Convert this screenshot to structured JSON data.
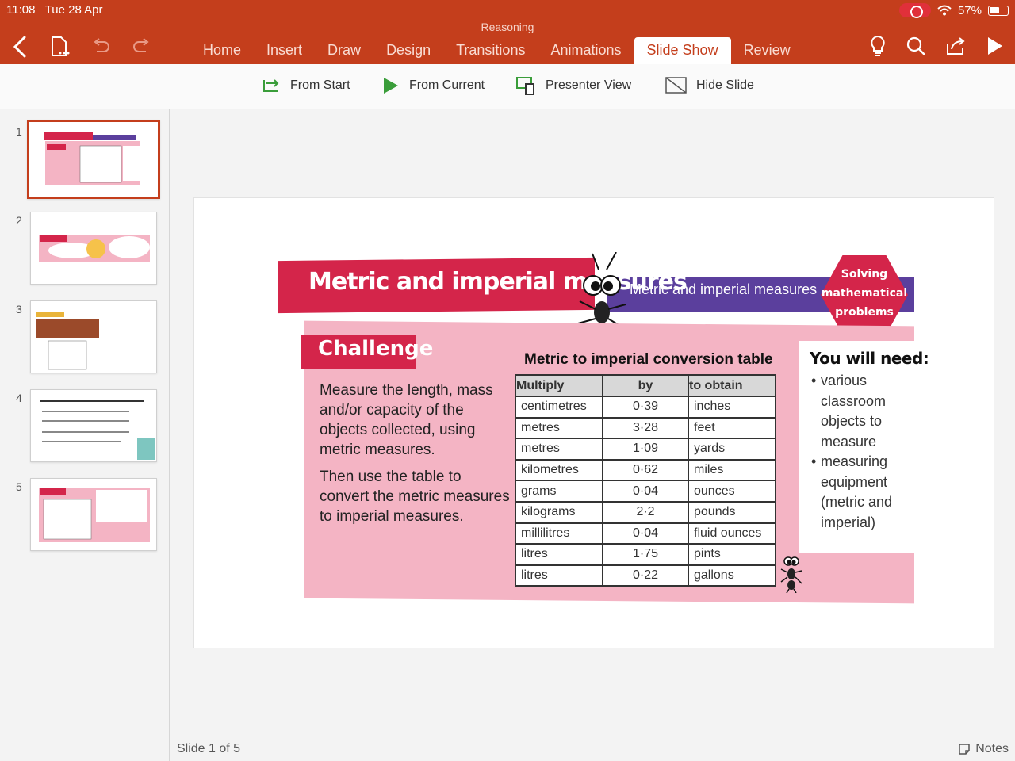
{
  "status": {
    "time": "11:08",
    "date": "Tue 28 Apr",
    "battery": "57%"
  },
  "document": {
    "title": "Reasoning"
  },
  "tabs": [
    {
      "label": "Home",
      "active": false
    },
    {
      "label": "Insert",
      "active": false
    },
    {
      "label": "Draw",
      "active": false
    },
    {
      "label": "Design",
      "active": false
    },
    {
      "label": "Transitions",
      "active": false
    },
    {
      "label": "Animations",
      "active": false
    },
    {
      "label": "Slide Show",
      "active": true
    },
    {
      "label": "Review",
      "active": false
    }
  ],
  "ribbon": {
    "from_start": "From Start",
    "from_current": "From Current",
    "presenter_view": "Presenter View",
    "hide_slide": "Hide Slide"
  },
  "thumbnails": {
    "numbers": [
      "1",
      "2",
      "3",
      "4",
      "5"
    ],
    "selected": 1
  },
  "slide": {
    "header_title": "Metric and imperial measures",
    "header_subtitle": "Metric and imperial measures",
    "badge_line1": "Solving",
    "badge_line2": "mathematical",
    "badge_line3": "problems",
    "challenge_label": "Challenge",
    "challenge_para1": "Measure the length, mass and/or capacity of the objects collected, using metric measures.",
    "challenge_para2": "Then use the table to convert the metric measures to imperial measures.",
    "table_title": "Metric to imperial conversion table",
    "table_headers": [
      "Multiply",
      "by",
      "to obtain"
    ],
    "table_rows": [
      [
        "centimetres",
        "0·39",
        "inches"
      ],
      [
        "metres",
        "3·28",
        "feet"
      ],
      [
        "metres",
        "1·09",
        "yards"
      ],
      [
        "kilometres",
        "0·62",
        "miles"
      ],
      [
        "grams",
        "0·04",
        "ounces"
      ],
      [
        "kilograms",
        "2·2",
        "pounds"
      ],
      [
        "millilitres",
        "0·04",
        "fluid ounces"
      ],
      [
        "litres",
        "1·75",
        "pints"
      ],
      [
        "litres",
        "0·22",
        "gallons"
      ]
    ],
    "need_title": "You will need:",
    "need_item1": "various classroom objects to measure",
    "need_item2": "measuring equipment (metric and imperial)"
  },
  "footer": {
    "slide_status": "Slide 1 of 5",
    "notes_label": "Notes"
  },
  "colors": {
    "accent": "#c43e1c",
    "slide_red": "#d4254a",
    "slide_purple": "#5b3f9d",
    "slide_pink": "#f4b4c4"
  }
}
